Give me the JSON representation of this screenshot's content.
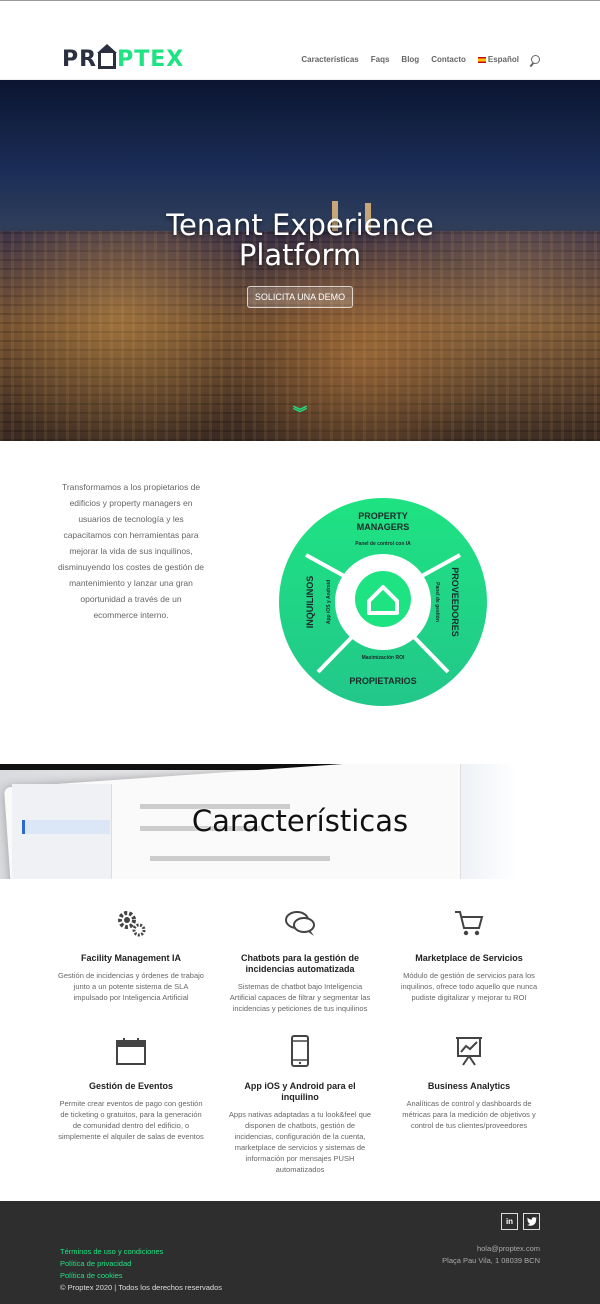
{
  "logo": {
    "part1": "PR",
    "part2": "PTEX"
  },
  "nav": {
    "items": [
      "Características",
      "Faqs",
      "Blog",
      "Contacto"
    ],
    "language": "Español"
  },
  "hero": {
    "title_line1": "Tenant Experience",
    "title_line2": "Platform",
    "cta": "SOLICITA UNA DEMO"
  },
  "intro": {
    "text": "Transformamos a los propietarios de edificios y property managers en usuarios de tecnología y les capacitamos con herramientas para mejorar la vida de sus inquilinos, disminuyendo los costes de gestión de mantenimiento y lanzar una gran oportunidad a través de un ecommerce interno."
  },
  "wheel": {
    "top": {
      "title_line1": "PROPERTY",
      "title_line2": "MANAGERS",
      "sub": "Panel de control con IA"
    },
    "right": {
      "title": "PROVEEDORES",
      "sub": "Panel de gestión"
    },
    "bottom": {
      "title": "PROPIETARIOS",
      "sub": "Maximización ROI"
    },
    "left": {
      "title": "INQUILINOS",
      "sub": "App iOS y Android"
    }
  },
  "band": {
    "title": "Características"
  },
  "features": [
    {
      "icon": "gears-icon",
      "title": "Facility Management IA",
      "text": "Gestión de incidencias y órdenes de trabajo junto a un potente sistema de SLA impulsado por Inteligencia Artificial"
    },
    {
      "icon": "chat-bubbles-icon",
      "title": "Chatbots para la gestión de incidencias automatizada",
      "text": "Sistemas de chatbot bajo Inteligencia Artificial capaces de filtrar y segmentar las incidencias y peticiones de tus inquilinos"
    },
    {
      "icon": "cart-icon",
      "title": "Marketplace de Servicios",
      "text": "Módulo de gestión de servicios para los inquilinos, ofrece todo aquello que nunca pudiste digitalizar y mejorar tu ROI"
    },
    {
      "icon": "calendar-icon",
      "title": "Gestión de Eventos",
      "text": "Permite crear eventos de pago con gestión de ticketing o gratuitos, para la generación de comunidad dentro del edificio, o simplemente el alquiler de salas de eventos"
    },
    {
      "icon": "mobile-icon",
      "title": "App iOS y Android para el inquilino",
      "text": "Apps nativas adaptadas a tu look&feel que disponen de chatbots, gestión de incidencias, configuración de la cuenta, marketplace de servicios y sistemas de información por mensajes PUSH automatizados"
    },
    {
      "icon": "presentation-chart-icon",
      "title": "Business Analytics",
      "text": "Analíticas de control y dashboards de métricas para la medición de objetivos y control de tus clientes/proveedores"
    }
  ],
  "footer": {
    "links": [
      "Términos de uso y condiciones",
      "Política de privacidad",
      "Política de cookies"
    ],
    "copyright": "© Proptex 2020 | Todos los derechos reservados",
    "email": "hola@proptex.com",
    "address": "Plaça Pau Vila, 1 08039 BCN",
    "social": [
      "in",
      "twitter"
    ]
  },
  "colors": {
    "brand_green": "#1ee382",
    "navy": "#2c2f3f",
    "footer_bg": "#2e2e2e"
  }
}
